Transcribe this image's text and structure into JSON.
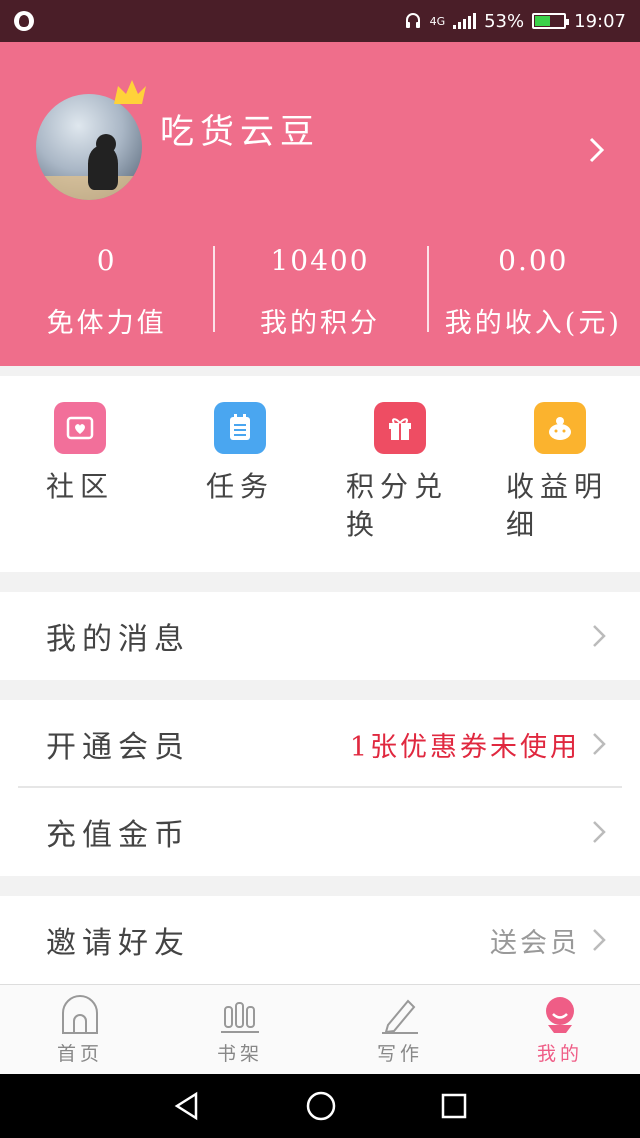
{
  "status": {
    "signal": "4G",
    "battery": "53%",
    "time": "19:07",
    "battery_level": 0.53
  },
  "profile": {
    "username": "吃货云豆"
  },
  "stats": [
    {
      "value": "0",
      "label": "免体力值"
    },
    {
      "value": "10400",
      "label": "我的积分"
    },
    {
      "value": "0.00",
      "label": "我的收入(元)"
    }
  ],
  "grid": [
    {
      "label": "社区",
      "icon": "community-icon",
      "color": "#f26f9a"
    },
    {
      "label": "任务",
      "icon": "tasks-icon",
      "color": "#4aa6f0"
    },
    {
      "label": "积分兑换",
      "icon": "gift-icon",
      "color": "#ee4d63"
    },
    {
      "label": "收益明细",
      "icon": "piggy-bank-icon",
      "color": "#fbb32e"
    }
  ],
  "menu": {
    "messages": {
      "label": "我的消息"
    },
    "vip": {
      "label": "开通会员",
      "extra": "1张优惠券未使用"
    },
    "recharge": {
      "label": "充值金币"
    },
    "invite": {
      "label": "邀请好友",
      "extra": "送会员"
    }
  },
  "tabs": [
    {
      "label": "首页",
      "icon": "home-icon"
    },
    {
      "label": "书架",
      "icon": "bookshelf-icon"
    },
    {
      "label": "写作",
      "icon": "pencil-icon"
    },
    {
      "label": "我的",
      "icon": "profile-icon"
    }
  ],
  "colors": {
    "brand_pink": "#ef6e8b",
    "accent_red": "#e0283f",
    "muted_gray": "#888888"
  }
}
